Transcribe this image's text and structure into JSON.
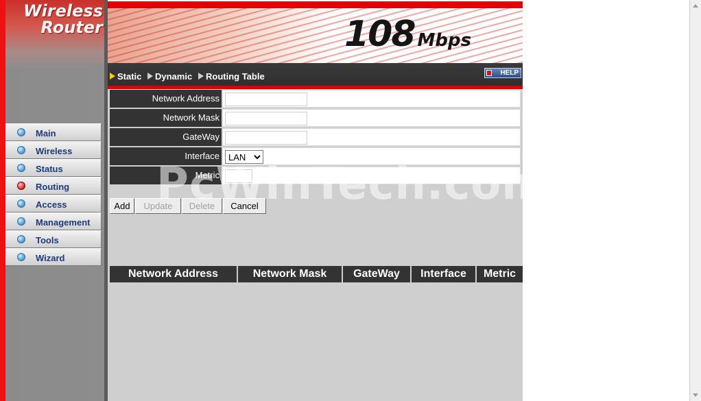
{
  "brand": {
    "logo_line1": "Wireless",
    "logo_line2": "Router",
    "speed_number": "108",
    "speed_unit": "Mbps"
  },
  "sidebar": {
    "items": [
      {
        "label": "Main",
        "active": false
      },
      {
        "label": "Wireless",
        "active": false
      },
      {
        "label": "Status",
        "active": false
      },
      {
        "label": "Routing",
        "active": true
      },
      {
        "label": "Access",
        "active": false
      },
      {
        "label": "Management",
        "active": false
      },
      {
        "label": "Tools",
        "active": false
      },
      {
        "label": "Wizard",
        "active": false
      }
    ]
  },
  "subnav": {
    "tabs": [
      {
        "label": "Static",
        "active": true
      },
      {
        "label": "Dynamic",
        "active": false
      },
      {
        "label": "Routing Table",
        "active": false
      }
    ],
    "help_label": "HELP"
  },
  "form": {
    "network_address_label": "Network Address",
    "network_address_value": "",
    "network_mask_label": "Network Mask",
    "network_mask_value": "",
    "gateway_label": "GateWay",
    "gateway_value": "",
    "interface_label": "Interface",
    "interface_value": "LAN",
    "metric_label": "Metric",
    "metric_value": ""
  },
  "buttons": {
    "add": "Add",
    "update": "Update",
    "delete": "Delete",
    "cancel": "Cancel"
  },
  "routing_table": {
    "columns": [
      "Network Address",
      "Network Mask",
      "GateWay",
      "Interface",
      "Metric"
    ],
    "rows": []
  },
  "watermark": "PcWinTech.com",
  "colors": {
    "accent_red": "#e50000",
    "header_dark": "#333333",
    "nav_text": "#1d3a7a"
  }
}
